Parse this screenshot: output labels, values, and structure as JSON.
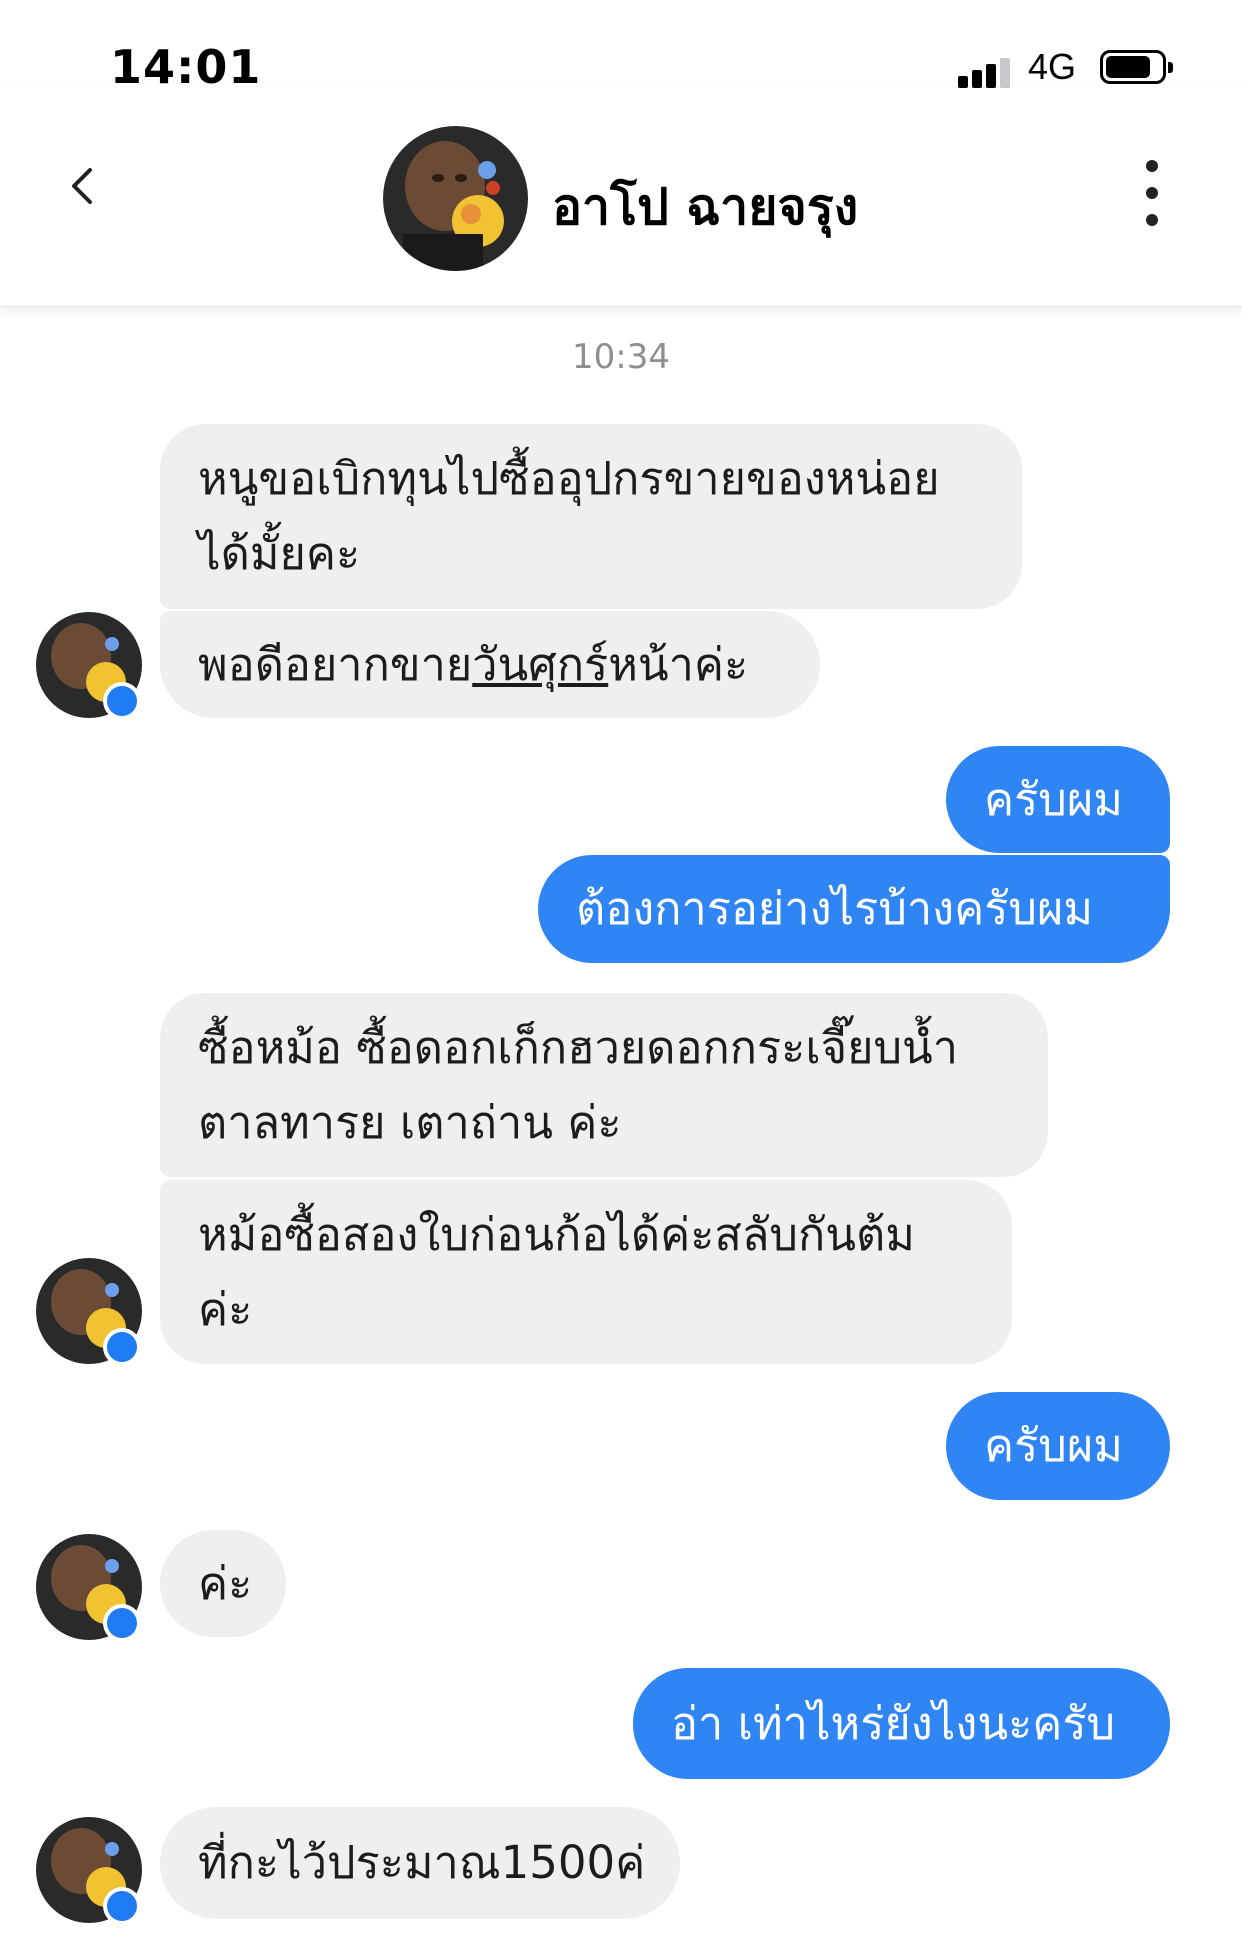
{
  "status_bar": {
    "time": "14:01",
    "network": "4G"
  },
  "header": {
    "contact_name": "อาโป ฉายจรุง"
  },
  "conversation": {
    "timestamp": "10:34",
    "messages": [
      {
        "side": "in",
        "lines": [
          "หนูขอเบิกทุนไปซื้ออุปกรขายของหน่อย",
          "ได้มั้ยคะ"
        ]
      },
      {
        "side": "in",
        "prefix": "พอดีอยากขาย",
        "link": "วันศุกร์",
        "suffix": "หน้าค่ะ"
      },
      {
        "side": "out",
        "text": "ครับผม"
      },
      {
        "side": "out",
        "text": "ต้องการอย่างไรบ้างครับผม"
      },
      {
        "side": "in",
        "lines": [
          "ซื้อหม้อ ซื้อดอกเก็กฮวยดอกกระเจี๊ยบน้ำ",
          "ตาลทารย เตาถ่าน ค่ะ"
        ]
      },
      {
        "side": "in",
        "lines": [
          "หม้อซื้อสองใบก่อนก้อได้ค่ะสลับกันต้ม",
          "ค่ะ"
        ]
      },
      {
        "side": "out",
        "text": "ครับผม"
      },
      {
        "side": "in",
        "text": "ค่ะ"
      },
      {
        "side": "out",
        "text": "อ่า เท่าไหร่ยังไงนะครับ"
      },
      {
        "side": "in",
        "text": "ที่กะไว้ประมาณ1500ค่"
      }
    ]
  },
  "colors": {
    "outgoing_bubble": "#2f85f3",
    "incoming_bubble": "#efefef",
    "messenger_badge": "#1e7bf2"
  }
}
